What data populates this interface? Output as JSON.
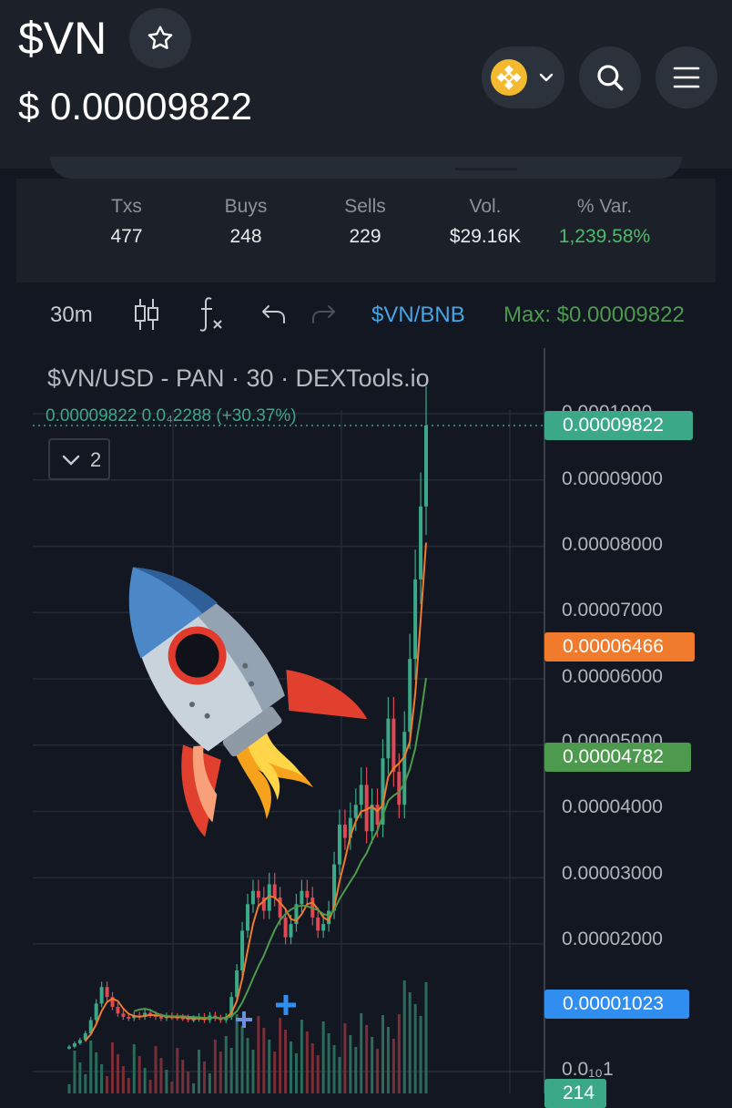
{
  "header": {
    "symbol": "$VN",
    "price": "$ 0.00009822",
    "icons": {
      "favorite": "star-icon",
      "chain": "bnb-chain-logo",
      "search": "search-icon",
      "menu": "hamburger-menu-icon"
    }
  },
  "stats": [
    {
      "label": "Txs",
      "value": "477"
    },
    {
      "label": "Buys",
      "value": "248"
    },
    {
      "label": "Sells",
      "value": "229"
    },
    {
      "label": "Vol.",
      "value": "$29.16K"
    },
    {
      "label": "% Var.",
      "value": "1,239.58%"
    }
  ],
  "toolbar": {
    "interval": "30m",
    "pair": "$VN/BNB",
    "max": "Max: $0.00009822",
    "icons": [
      "candles-icon",
      "indicators-fx-icon",
      "undo-icon",
      "redo-icon"
    ]
  },
  "chart_data": {
    "type": "candlestick",
    "title": "$VN/USD - PAN · 30 · DEXTools.io",
    "ohlc_readout": "0.00009822  0.0₄2288 (+30.37%)",
    "indicators_collapsed": "2",
    "y_ticks": [
      "0.0001000",
      "0.00009000",
      "0.00008000",
      "0.00007000",
      "0.00006000",
      "0.00005000",
      "0.00004000",
      "0.00003000",
      "0.00002000",
      "0.0₁₀1"
    ],
    "ylim": [
      5e-06,
      0.0001
    ],
    "price_tags": [
      {
        "label": "0.00009822",
        "value": 9.822e-05,
        "color": "#3ba987"
      },
      {
        "label": "0.00006466",
        "value": 6.466e-05,
        "color": "#f07b2c"
      },
      {
        "label": "0.00004782",
        "value": 4.782e-05,
        "color": "#4d9a4e"
      },
      {
        "label": "0.00001023",
        "value": 1.023e-05,
        "color": "#2f8ef0"
      },
      {
        "label": "214",
        "value": null,
        "color": "#3ba987"
      }
    ],
    "series": [
      {
        "name": "close",
        "values": [
          4.5e-06,
          5e-06,
          5.5e-06,
          6.5e-06,
          8.5e-06,
          1.1e-05,
          1.35e-05,
          1.2e-05,
          1.05e-05,
          9.5e-06,
          9e-06,
          8.8e-06,
          9.2e-06,
          9e-06,
          9.6e-06,
          9.3e-06,
          9e-06,
          8.8e-06,
          9.1e-06,
          9e-06,
          8.9e-06,
          8.8e-06,
          8.6e-06,
          8.7e-06,
          9e-06,
          8.5e-06,
          9.2e-06,
          8.8e-06,
          8.5e-06,
          9e-06,
          1.2e-05,
          1.6e-05,
          2.2e-05,
          2.6e-05,
          2.8e-05,
          2.7e-05,
          2.5e-05,
          2.9e-05,
          2.7e-05,
          2.4e-05,
          2.1e-05,
          2.3e-05,
          2.6e-05,
          2.8e-05,
          2.7e-05,
          2.4e-05,
          2.2e-05,
          2.3e-05,
          2.5e-05,
          3.2e-05,
          3.8e-05,
          3.6e-05,
          3.9e-05,
          4.1e-05,
          4.4e-05,
          3.7e-05,
          4.1e-05,
          3.8e-05,
          4.8e-05,
          5.4e-05,
          4.6e-05,
          4.1e-05,
          5.2e-05,
          6.3e-05,
          7.5e-05,
          8.6e-05,
          9.822e-05
        ]
      },
      {
        "name": "ma-fast",
        "color": "#f07b2c"
      },
      {
        "name": "ma-slow",
        "color": "#4d9a4e"
      }
    ],
    "colors": {
      "up": "#3ba987",
      "down": "#e04854",
      "grid": "#252a36"
    }
  }
}
